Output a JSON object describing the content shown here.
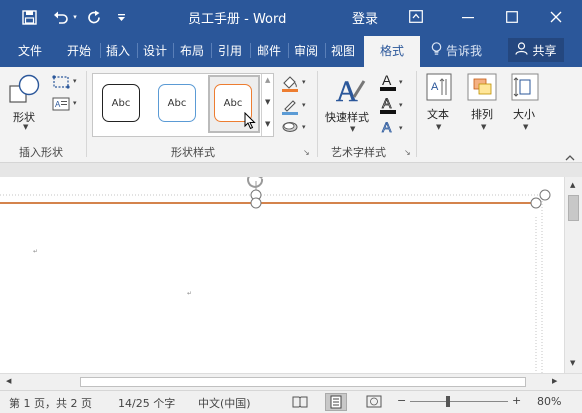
{
  "window": {
    "title": "员工手册 - Word",
    "login": "登录"
  },
  "tabs": [
    {
      "label": "文件"
    },
    {
      "label": "开始"
    },
    {
      "label": "插入"
    },
    {
      "label": "设计"
    },
    {
      "label": "布局"
    },
    {
      "label": "引用"
    },
    {
      "label": "邮件"
    },
    {
      "label": "审阅"
    },
    {
      "label": "视图"
    }
  ],
  "active_tab": "格式",
  "tell_me": "告诉我",
  "share": "共享",
  "ribbon": {
    "insert_shapes": {
      "shapes_label": "形状",
      "group_label": "插入形状"
    },
    "shape_styles": {
      "gallery": [
        {
          "label": "Abc",
          "border": "#222222"
        },
        {
          "label": "Abc",
          "border": "#5b9bd5"
        },
        {
          "label": "Abc",
          "border": "#ed7d31"
        }
      ],
      "group_label": "形状样式"
    },
    "wordart": {
      "quick_styles_label": "快速样式",
      "group_label": "艺术字样式"
    },
    "text_label": "文本",
    "arrange_label": "排列",
    "size_label": "大小"
  },
  "colors": {
    "brand": "#2b579a",
    "orange_line": "#c55a11"
  },
  "status": {
    "page": "第 1 页，共 2 页",
    "words": "14/25 个字",
    "language": "中文(中国)",
    "zoom": "80%",
    "zoom_level": 0.8
  }
}
